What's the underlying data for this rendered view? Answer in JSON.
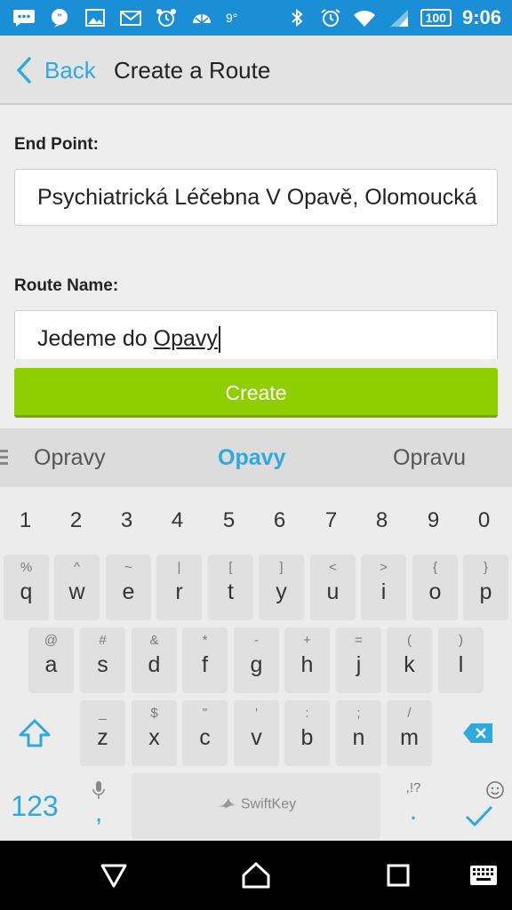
{
  "status_bar": {
    "temperature": "9°",
    "battery": "100",
    "time": "9:06",
    "icons": [
      "chat-icon",
      "message-icon",
      "image-icon",
      "mail-icon",
      "alarm-badge-icon",
      "weather-icon",
      "bluetooth-icon",
      "alarm-clock-icon",
      "wifi-icon",
      "signal-icon",
      "battery-icon"
    ]
  },
  "app_bar": {
    "back_label": "Back",
    "title": "Create a Route"
  },
  "form": {
    "end_point_label": "End Point:",
    "end_point_value": "Psychiatrická Léčebna V Opavě, Olomoucká",
    "route_name_label": "Route Name:",
    "route_name_prefix": "Jedeme do ",
    "route_name_composing": "Opavy",
    "create_label": "Create"
  },
  "keyboard": {
    "suggestions": [
      "Opravy",
      "Opavy",
      "Opravu"
    ],
    "numbers": [
      "1",
      "2",
      "3",
      "4",
      "5",
      "6",
      "7",
      "8",
      "9",
      "0"
    ],
    "row1": [
      {
        "pri": "q",
        "sec": "%"
      },
      {
        "pri": "w",
        "sec": "^"
      },
      {
        "pri": "e",
        "sec": "~"
      },
      {
        "pri": "r",
        "sec": "|"
      },
      {
        "pri": "t",
        "sec": "["
      },
      {
        "pri": "y",
        "sec": "]"
      },
      {
        "pri": "u",
        "sec": "<"
      },
      {
        "pri": "i",
        "sec": ">"
      },
      {
        "pri": "o",
        "sec": "{"
      },
      {
        "pri": "p",
        "sec": "}"
      }
    ],
    "row2": [
      {
        "pri": "a",
        "sec": "@"
      },
      {
        "pri": "s",
        "sec": "#"
      },
      {
        "pri": "d",
        "sec": "&"
      },
      {
        "pri": "f",
        "sec": "*"
      },
      {
        "pri": "g",
        "sec": "-"
      },
      {
        "pri": "h",
        "sec": "+"
      },
      {
        "pri": "j",
        "sec": "="
      },
      {
        "pri": "k",
        "sec": "("
      },
      {
        "pri": "l",
        "sec": ")"
      }
    ],
    "row3": [
      {
        "pri": "z",
        "sec": "_"
      },
      {
        "pri": "x",
        "sec": "$"
      },
      {
        "pri": "c",
        "sec": "\""
      },
      {
        "pri": "v",
        "sec": "'"
      },
      {
        "pri": "b",
        "sec": ":"
      },
      {
        "pri": "n",
        "sec": ";"
      },
      {
        "pri": "m",
        "sec": "/"
      }
    ],
    "mode_label": "123",
    "comma": ",",
    "space_brand": "SwiftKey",
    "dot": ".",
    "dot_sec": ",!?",
    "accent_color": "#2ea9df"
  },
  "colors": {
    "status_bar": "#1a8fd6",
    "create_button": "#8fce00",
    "accent": "#2ea9df"
  }
}
